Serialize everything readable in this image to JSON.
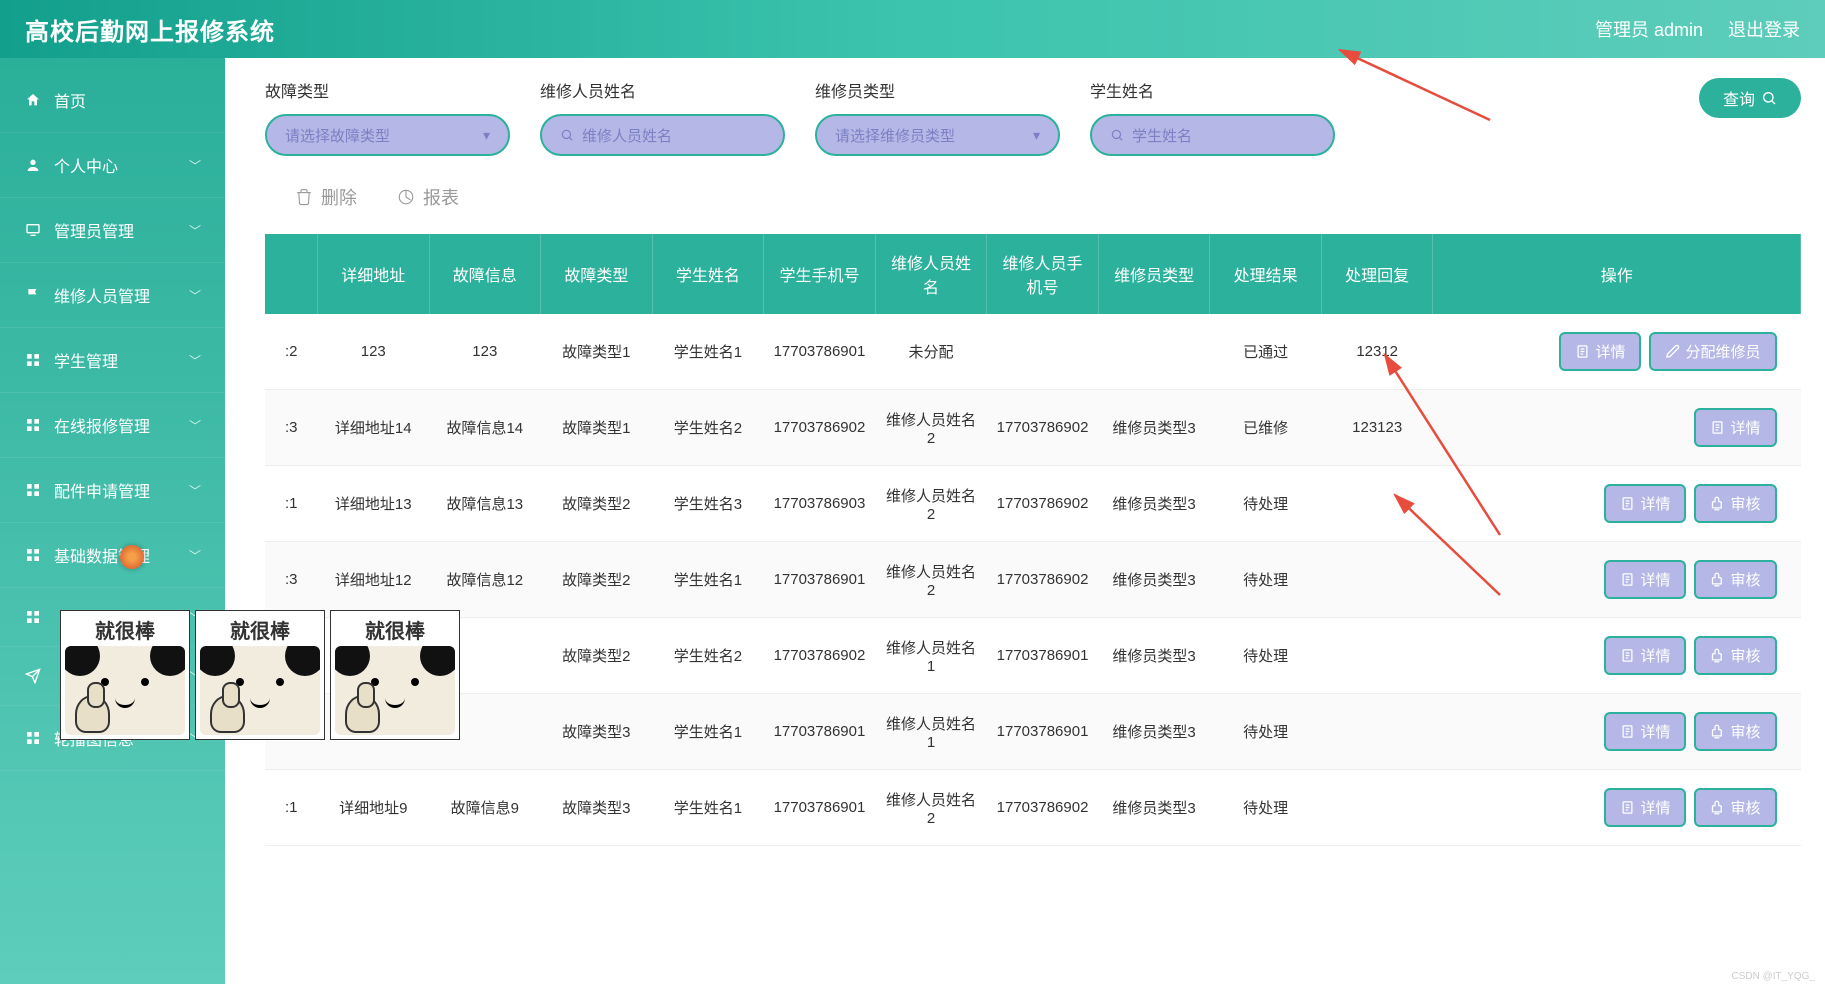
{
  "header": {
    "title": "高校后勤网上报修系统",
    "user_label": "管理员 admin",
    "logout_label": "退出登录"
  },
  "sidebar": {
    "items": [
      {
        "icon": "home",
        "label": "首页",
        "expandable": false
      },
      {
        "icon": "user",
        "label": "个人中心",
        "expandable": true
      },
      {
        "icon": "screen",
        "label": "管理员管理",
        "expandable": true
      },
      {
        "icon": "flag",
        "label": "维修人员管理",
        "expandable": true
      },
      {
        "icon": "grid",
        "label": "学生管理",
        "expandable": true
      },
      {
        "icon": "grid",
        "label": "在线报修管理",
        "expandable": true
      },
      {
        "icon": "grid",
        "label": "配件申请管理",
        "expandable": true
      },
      {
        "icon": "grid",
        "label": "基础数据管理",
        "expandable": true
      },
      {
        "icon": "grid",
        "label": "",
        "expandable": true,
        "hidden_by_sticker": true
      },
      {
        "icon": "send",
        "label": "",
        "expandable": true,
        "hidden_by_sticker": true
      },
      {
        "icon": "grid",
        "label": "轮播图信息",
        "expandable": true
      }
    ]
  },
  "filters": {
    "f1": {
      "label": "故障类型",
      "placeholder": "请选择故障类型",
      "type": "select"
    },
    "f2": {
      "label": "维修人员姓名",
      "placeholder": "维修人员姓名",
      "type": "text"
    },
    "f3": {
      "label": "维修员类型",
      "placeholder": "请选择维修员类型",
      "type": "select"
    },
    "f4": {
      "label": "学生姓名",
      "placeholder": "学生姓名",
      "type": "text"
    },
    "query_label": "查询"
  },
  "toolbar": {
    "delete_label": "删除",
    "report_label": "报表"
  },
  "table": {
    "headers": [
      "",
      "详细地址",
      "故障信息",
      "故障类型",
      "学生姓名",
      "学生手机号",
      "维修人员姓名",
      "维修人员手机号",
      "维修员类型",
      "处理结果",
      "处理回复",
      "操作"
    ],
    "rows": [
      {
        "idx": ":2",
        "addr": "123",
        "fault": "123",
        "type": "故障类型1",
        "sname": "学生姓名1",
        "sphone": "17703786901",
        "rname": "未分配",
        "rphone": "",
        "rtype": "",
        "result": "已通过",
        "reply": "12312",
        "ops": [
          "detail",
          "assign"
        ]
      },
      {
        "idx": ":3",
        "addr": "详细地址14",
        "fault": "故障信息14",
        "type": "故障类型1",
        "sname": "学生姓名2",
        "sphone": "17703786902",
        "rname": "维修人员姓名2",
        "rphone": "17703786902",
        "rtype": "维修员类型3",
        "result": "已维修",
        "reply": "123123",
        "ops": [
          "detail"
        ]
      },
      {
        "idx": ":1",
        "addr": "详细地址13",
        "fault": "故障信息13",
        "type": "故障类型2",
        "sname": "学生姓名3",
        "sphone": "17703786903",
        "rname": "维修人员姓名2",
        "rphone": "17703786902",
        "rtype": "维修员类型3",
        "result": "待处理",
        "reply": "",
        "ops": [
          "detail",
          "audit"
        ]
      },
      {
        "idx": ":3",
        "addr": "详细地址12",
        "fault": "故障信息12",
        "type": "故障类型2",
        "sname": "学生姓名1",
        "sphone": "17703786901",
        "rname": "维修人员姓名2",
        "rphone": "17703786902",
        "rtype": "维修员类型3",
        "result": "待处理",
        "reply": "",
        "ops": [
          "detail",
          "audit"
        ]
      },
      {
        "idx": "",
        "addr": "",
        "fault": "",
        "type": "故障类型2",
        "sname": "学生姓名2",
        "sphone": "17703786902",
        "rname": "维修人员姓名1",
        "rphone": "17703786901",
        "rtype": "维修员类型3",
        "result": "待处理",
        "reply": "",
        "ops": [
          "detail",
          "audit"
        ]
      },
      {
        "idx": "",
        "addr": "",
        "fault": "",
        "type": "故障类型3",
        "sname": "学生姓名1",
        "sphone": "17703786901",
        "rname": "维修人员姓名1",
        "rphone": "17703786901",
        "rtype": "维修员类型3",
        "result": "待处理",
        "reply": "",
        "ops": [
          "detail",
          "audit"
        ]
      },
      {
        "idx": ":1",
        "addr": "详细地址9",
        "fault": "故障信息9",
        "type": "故障类型3",
        "sname": "学生姓名1",
        "sphone": "17703786901",
        "rname": "维修人员姓名2",
        "rphone": "17703786902",
        "rtype": "维修员类型3",
        "result": "待处理",
        "reply": "",
        "ops": [
          "detail",
          "audit"
        ]
      }
    ],
    "op_labels": {
      "detail": "详情",
      "assign": "分配维修员",
      "audit": "审核"
    }
  },
  "sticker_text": "就很棒",
  "watermark": "CSDN @IT_YQG_"
}
